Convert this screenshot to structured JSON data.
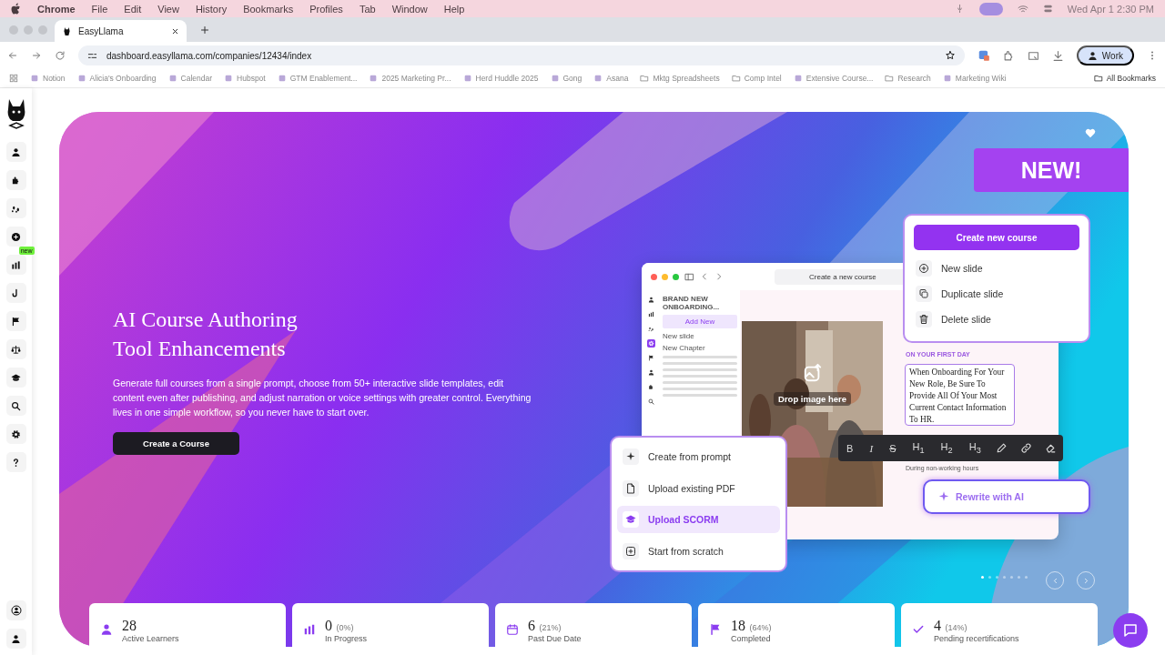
{
  "menu_bar": {
    "app": "Chrome",
    "items": [
      "File",
      "Edit",
      "View",
      "History",
      "Bookmarks",
      "Profiles",
      "Tab",
      "Window",
      "Help"
    ],
    "clock": "Wed Apr 1  2:30 PM"
  },
  "browser": {
    "tab": {
      "title": "EasyLlama"
    },
    "url": "dashboard.easyllama.com/companies/12434/index",
    "profile": "Work",
    "bookmarks": [
      {
        "kind": "link",
        "label": "Notion"
      },
      {
        "kind": "link",
        "label": "Alicia's Onboarding"
      },
      {
        "kind": "link",
        "label": "Calendar"
      },
      {
        "kind": "link",
        "label": "Hubspot"
      },
      {
        "kind": "link",
        "label": "GTM Enablement..."
      },
      {
        "kind": "link",
        "label": "2025 Marketing Pr..."
      },
      {
        "kind": "link",
        "label": "Herd Huddle 2025"
      },
      {
        "kind": "link",
        "label": "Gong"
      },
      {
        "kind": "link",
        "label": "Asana"
      },
      {
        "kind": "folder",
        "label": "Mktg Spreadsheets"
      },
      {
        "kind": "folder",
        "label": "Comp Intel"
      },
      {
        "kind": "link",
        "label": "Extensive Course..."
      },
      {
        "kind": "folder",
        "label": "Research"
      },
      {
        "kind": "link",
        "label": "Marketing Wiki"
      }
    ],
    "all_bookmarks": "All Bookmarks"
  },
  "sidebar": {
    "new_badge": "new"
  },
  "hero": {
    "title_lines": [
      "AI Course Authoring",
      "Tool Enhancements"
    ],
    "description": "Generate full courses from a single prompt, choose from 50+ interactive slide templates, edit content even after publishing, and adjust narration or voice settings with greater control. Everything lives in one simple workflow, so you never have to start over.",
    "button": "Create a Course",
    "badge": "NEW!",
    "mockup": {
      "window_title": "Create a new course",
      "course_name": "BRAND NEW ONBOARDING...",
      "add_new": "Add New",
      "menu_items": [
        "New slide",
        "New Chapter"
      ],
      "drop_text": "Drop image here",
      "section_label": "ON YOUR FIRST DAY",
      "slide_text": "When Onboarding For Your New Role, Be Sure To Provide All Of Your Most Current Contact Information To HR.",
      "slide_note": "During non-working hours",
      "toolbar": [
        {
          "kind": "text",
          "label": "B"
        },
        {
          "kind": "text",
          "label": "I"
        },
        {
          "kind": "strike",
          "label": "S"
        },
        {
          "kind": "text",
          "label": "H$_{1}$"
        },
        {
          "kind": "text",
          "label": "H$_{2}$"
        },
        {
          "kind": "text",
          "label": "H$_{3}$"
        },
        {
          "kind": "pencil"
        },
        {
          "kind": "link"
        },
        {
          "kind": "eraser"
        }
      ],
      "rewrite": "Rewrite with AI",
      "create_menu": {
        "button": "Create new course",
        "items": [
          "New slide",
          "Duplicate slide",
          "Delete slide"
        ]
      },
      "options": [
        {
          "label": "Create from prompt",
          "selected": false
        },
        {
          "label": "Upload existing PDF",
          "selected": false
        },
        {
          "label": "Upload SCORM",
          "selected": true
        },
        {
          "label": "Start from scratch",
          "selected": false
        }
      ]
    },
    "carousel": [
      {
        "selected": true
      },
      {
        "selected": false
      },
      {
        "selected": false
      },
      {
        "selected": false
      },
      {
        "selected": false
      },
      {
        "selected": false
      },
      {
        "selected": false
      }
    ]
  },
  "stats": [
    {
      "value": "28",
      "label": "Active Learners"
    },
    {
      "value": "0",
      "percent": "(0%)",
      "label": "In Progress"
    },
    {
      "value": "6",
      "percent": "(21%)",
      "label": "Past Due Date"
    },
    {
      "value": "18",
      "percent": "(64%)",
      "label": "Completed"
    },
    {
      "value": "4",
      "percent": "(14%)",
      "label": "Pending recertifications"
    }
  ]
}
